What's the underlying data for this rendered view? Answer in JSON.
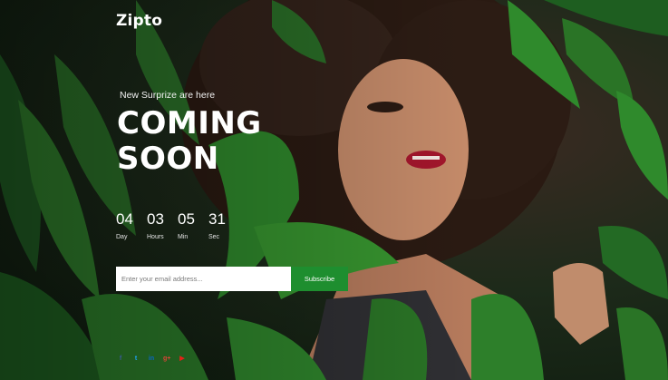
{
  "brand": {
    "logo": "Zipto"
  },
  "hero": {
    "tagline": "New Surprize are here",
    "headline_line1": "COMING",
    "headline_line2": "SOON"
  },
  "countdown": [
    {
      "value": "04",
      "label": "Day"
    },
    {
      "value": "03",
      "label": "Hours"
    },
    {
      "value": "05",
      "label": "Min"
    },
    {
      "value": "31",
      "label": "Sec"
    }
  ],
  "subscribe": {
    "placeholder": "Enter your email address...",
    "button_label": "Subscribe",
    "button_color": "#1e8e2f"
  },
  "socials": [
    {
      "icon": "facebook-icon",
      "glyph": "f",
      "color": "#3b5998"
    },
    {
      "icon": "twitter-icon",
      "glyph": "t",
      "color": "#1da1f2"
    },
    {
      "icon": "linkedin-icon",
      "glyph": "in",
      "color": "#0a66c2"
    },
    {
      "icon": "google-plus-icon",
      "glyph": "g+",
      "color": "#db4437"
    },
    {
      "icon": "youtube-icon",
      "glyph": "▶",
      "color": "#e62117"
    }
  ]
}
